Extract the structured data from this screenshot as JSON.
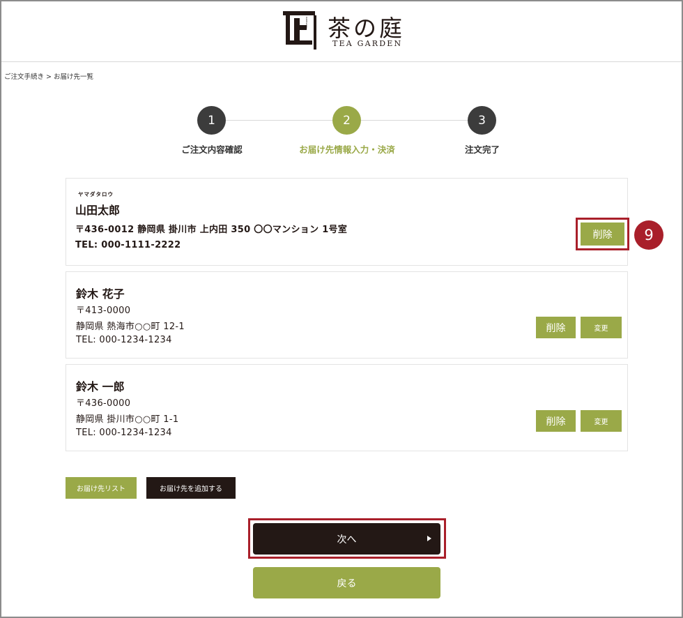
{
  "brand": {
    "name_jp": "茶の庭",
    "name_en": "TEA GARDEN",
    "mark_glyph": "上",
    "mark_vertical_text": "KAKEGAWA"
  },
  "breadcrumb": "ご注文手続き > お届け先一覧",
  "steps": [
    {
      "number": "1",
      "label": "ご注文内容確認"
    },
    {
      "number": "2",
      "label": "お届け先情報入力・決済"
    },
    {
      "number": "3",
      "label": "注文完了"
    }
  ],
  "current_step": 2,
  "addresses": [
    {
      "ruby": "ヤマダタロウ",
      "name": "山田太郎",
      "address_line": "〒436-0012 静岡県 掛川市 上内田 350 〇〇マンション 1号室",
      "tel": "TEL: 000-1111-2222",
      "delete_label": "削除"
    },
    {
      "name": "鈴木 花子",
      "postal": "〒413-0000",
      "address": "静岡県 熱海市○○町 12-1",
      "tel": "TEL: 000-1234-1234",
      "delete_label": "削除",
      "change_label": "変更"
    },
    {
      "name": "鈴木 一郎",
      "postal": "〒436-0000",
      "address": "静岡県 掛川市○○町 1-1",
      "tel": "TEL: 000-1234-1234",
      "delete_label": "削除",
      "change_label": "変更"
    }
  ],
  "actions": {
    "address_list_label": "お届け先リスト",
    "add_address_label": "お届け先を追加する",
    "next_label": "次へ",
    "back_label": "戻る"
  },
  "annotation_marker": "9",
  "colors": {
    "accent_green": "#9aa948",
    "dark": "#231815",
    "step_inactive": "#3c3c3c",
    "highlight_red": "#a91f2a"
  }
}
